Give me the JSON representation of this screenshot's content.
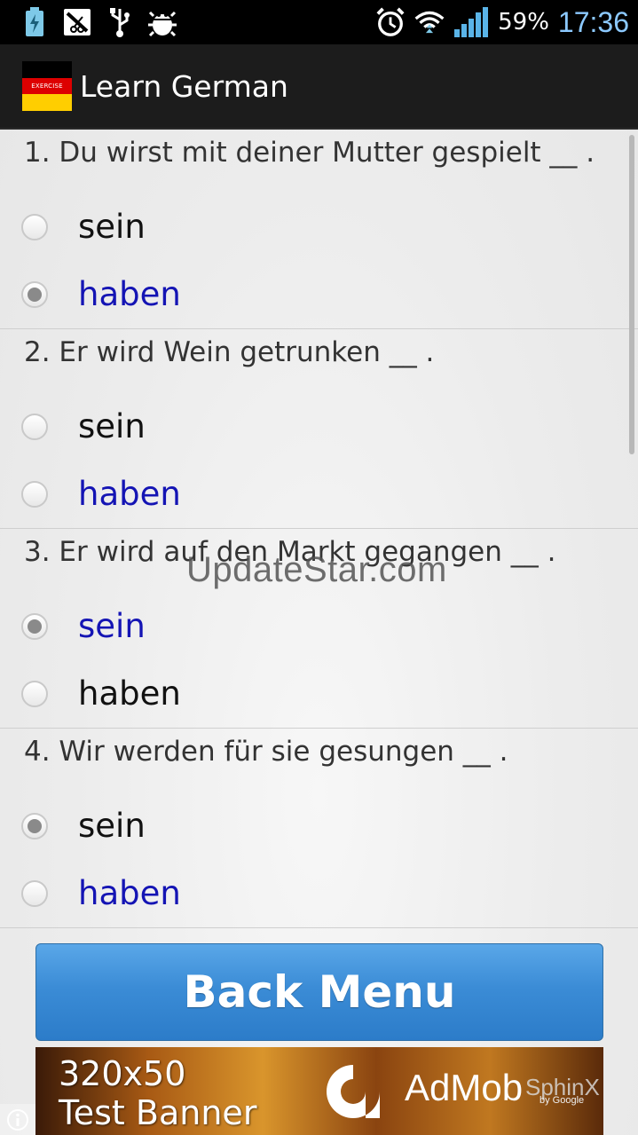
{
  "status_bar": {
    "icons": [
      "battery-charging-icon",
      "sim-toolkit-icon",
      "usb-icon",
      "debug-bug-icon",
      "alarm-icon",
      "wifi-icon",
      "signal-icon"
    ],
    "battery": "59%",
    "time": "17:36",
    "time_color": "#8cc9ff"
  },
  "action_bar": {
    "flag_text": "EXERCISE",
    "title": "Learn German"
  },
  "questions": [
    {
      "text": "1. Du wirst mit deiner Mutter gespielt __ .",
      "options": [
        "sein",
        "haben"
      ],
      "selected": "haben"
    },
    {
      "text": "2. Er wird Wein getrunken __ .",
      "options": [
        "sein",
        "haben"
      ],
      "selected": "haben"
    },
    {
      "text": "3. Er wird auf den Markt gegangen __ .",
      "options": [
        "sein",
        "haben"
      ],
      "selected": "sein"
    },
    {
      "text": "4. Wir werden für sie gesungen __ .",
      "options": [
        "sein",
        "haben"
      ],
      "selected": "sein"
    }
  ],
  "watermark": "UpdateStar.com",
  "back_button": "Back Menu",
  "banner": {
    "line1": "320x50",
    "line2": "Test Banner",
    "brand": "AdMob",
    "brand_sub": "by Google",
    "overlay": "SphinX"
  },
  "colors": {
    "selected_option": "#1414b4",
    "button": "#3b8cd6"
  }
}
